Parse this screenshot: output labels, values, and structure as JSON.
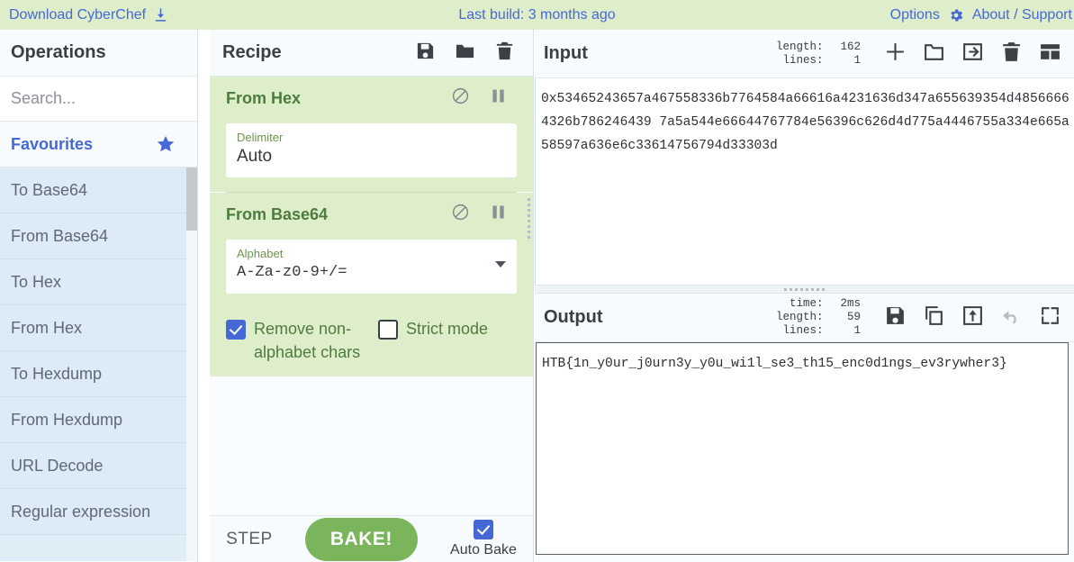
{
  "banner": {
    "download_label": "Download CyberChef",
    "download_icon": "download-icon",
    "last_build": "Last build: 3 months ago",
    "options_label": "Options",
    "options_icon": "gear-icon",
    "about_label": "About / Support",
    "bg_color": "#dfeeca",
    "link_color": "#4668d6"
  },
  "operations": {
    "title": "Operations",
    "search_placeholder": "Search...",
    "favourites_label": "Favourites",
    "favourites_icon": "star-icon",
    "items": [
      {
        "label": "To Base64"
      },
      {
        "label": "From Base64"
      },
      {
        "label": "To Hex"
      },
      {
        "label": "From Hex"
      },
      {
        "label": "To Hexdump"
      },
      {
        "label": "From Hexdump"
      },
      {
        "label": "URL Decode"
      },
      {
        "label": "Regular expression"
      }
    ]
  },
  "recipe": {
    "title": "Recipe",
    "icons": [
      "save-icon",
      "folder-icon",
      "trash-icon"
    ],
    "operations": [
      {
        "name": "From Hex",
        "disable_icon": "disable-icon",
        "pause_icon": "pause-icon",
        "arg_label": "Delimiter",
        "arg_value": "Auto"
      },
      {
        "name": "From Base64",
        "disable_icon": "disable-icon",
        "pause_icon": "pause-icon",
        "arg_label": "Alphabet",
        "arg_value": "A-Za-z0-9+/=",
        "checkbox_1_label": "Remove non-alphabet chars",
        "checkbox_1_checked": true,
        "checkbox_2_label": "Strict mode",
        "checkbox_2_checked": false
      }
    ],
    "step_label": "STEP",
    "bake_label": "BAKE!",
    "bake_color": "#7ab55c",
    "autobake_label": "Auto Bake",
    "autobake_checked": true
  },
  "input": {
    "title": "Input",
    "meta": [
      {
        "key": "length:",
        "value": "162"
      },
      {
        "key": "lines:",
        "value": "1"
      }
    ],
    "icons": [
      "plus-icon",
      "folder-open-icon",
      "sign-in-icon",
      "trash-icon",
      "tabs-icon"
    ],
    "value": "0x53465243657a467558336b7764584a66616a4231636d347a655639354d48566664326b786246439 7a5a544e66644767784e56396c626d4d775a4446755a334e665a58597a636e6c33614756794d33303d"
  },
  "output": {
    "title": "Output",
    "meta": [
      {
        "key": "time:",
        "value": "2ms"
      },
      {
        "key": "length:",
        "value": "59"
      },
      {
        "key": "lines:",
        "value": "1"
      }
    ],
    "icons": [
      "save-icon",
      "copy-icon",
      "bake-to-input-icon",
      "undo-icon",
      "maximise-icon"
    ],
    "value": "HTB{1n_y0ur_j0urn3y_y0u_wi1l_se3_th15_enc0d1ngs_ev3rywher3}"
  }
}
